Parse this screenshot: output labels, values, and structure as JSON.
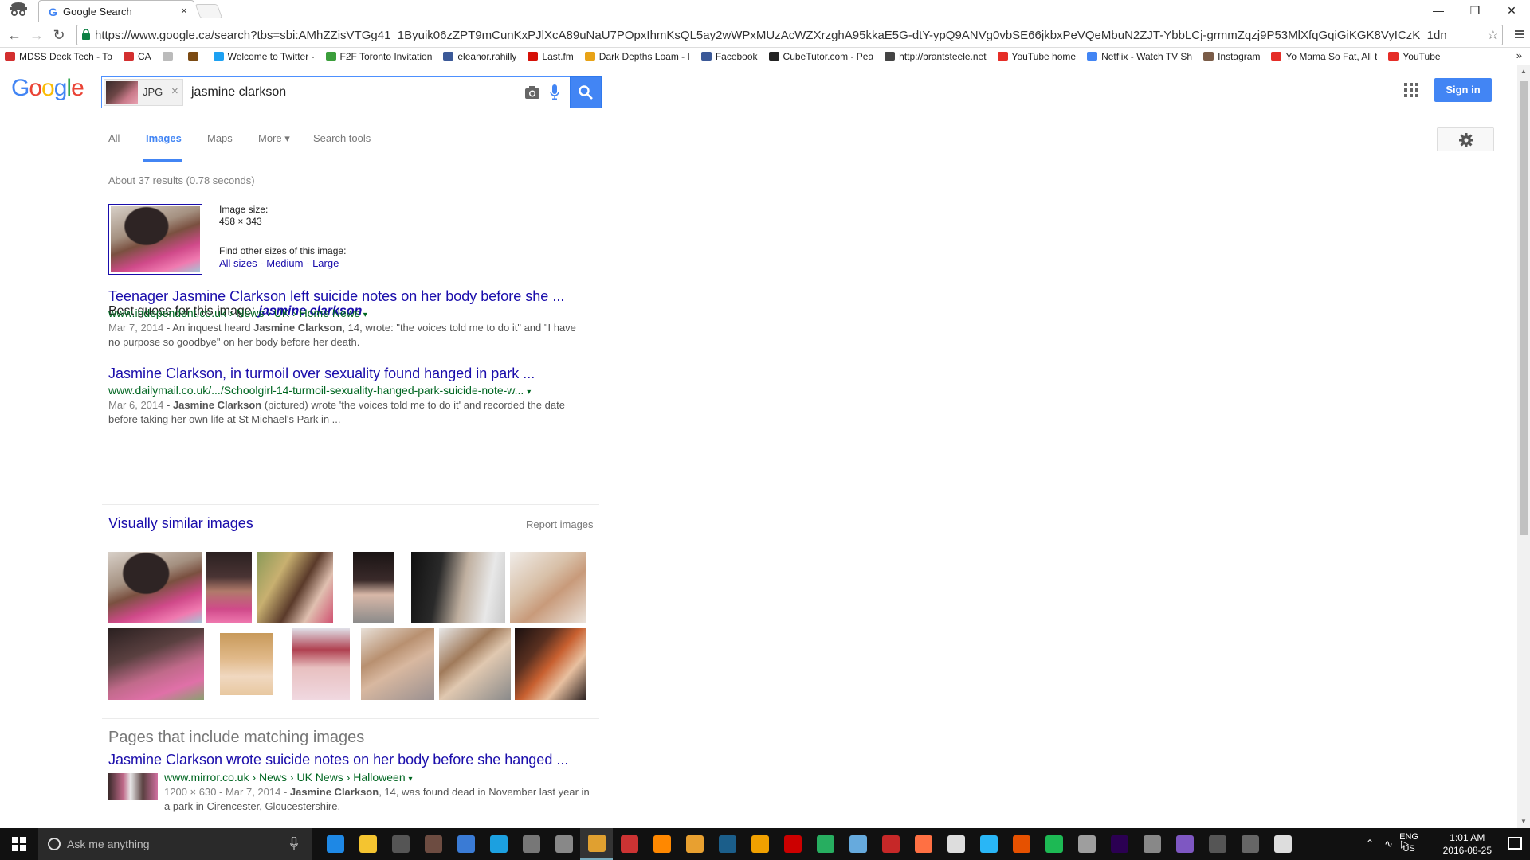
{
  "browser": {
    "tab_title": "Google Search",
    "tab_close": "×",
    "url": "https://www.google.ca/search?tbs=sbi:AMhZZisVTGg41_1Byuik06zZPT9mCunKxPJlXcA89uNaU7POpxIhmKsQL5ay2wWPxMUzAcWZXrzghA95kkaE5G-dtY-ypQ9ANVg0vbSE66jkbxPeVQeMbuN2ZJT-YbbLCj-grmmZqzj9P53MlXfqGqiGiKGK8VyICzK_1dn",
    "bookmarks": [
      {
        "label": "MDSS Deck Tech - To",
        "color": "#d32f2f"
      },
      {
        "label": "CA",
        "color": "#d32f2f"
      },
      {
        "label": "",
        "color": "#bbbbbb"
      },
      {
        "label": "",
        "color": "#7b4a12"
      },
      {
        "label": "Welcome to Twitter -",
        "color": "#1da1f2"
      },
      {
        "label": "F2F Toronto Invitation",
        "color": "#3b9e3b"
      },
      {
        "label": "eleanor.rahilly",
        "color": "#3b5998"
      },
      {
        "label": "Last.fm",
        "color": "#d51007"
      },
      {
        "label": "Dark Depths Loam - I",
        "color": "#e8a317"
      },
      {
        "label": "Facebook",
        "color": "#3b5998"
      },
      {
        "label": "CubeTutor.com - Pea",
        "color": "#222222"
      },
      {
        "label": "http://brantsteele.net",
        "color": "#444444"
      },
      {
        "label": "YouTube home",
        "color": "#e52d27"
      },
      {
        "label": "Netflix - Watch TV Sh",
        "color": "#4285f4"
      },
      {
        "label": "Instagram",
        "color": "#7a5c48"
      },
      {
        "label": "Yo Mama So Fat, All t",
        "color": "#e52d27"
      },
      {
        "label": "YouTube",
        "color": "#e52d27"
      }
    ],
    "bookmarks_more": "»"
  },
  "google": {
    "logo": [
      "G",
      "o",
      "o",
      "g",
      "l",
      "e"
    ],
    "logo_colors": [
      "#4285f4",
      "#ea4335",
      "#fbbc05",
      "#4285f4",
      "#34a853",
      "#ea4335"
    ],
    "chip_label": "JPG",
    "chip_close": "×",
    "query": "jasmine clarkson",
    "signin": "Sign in",
    "tabs": {
      "all": "All",
      "images": "Images",
      "maps": "Maps",
      "more": "More ▾",
      "tools": "Search tools"
    }
  },
  "results": {
    "stats": "About 37 results (0.78 seconds)",
    "image_size_label": "Image size:",
    "image_size_value": "458 × 343",
    "other_sizes_label": "Find other sizes of this image:",
    "size_all": "All sizes",
    "size_sep1": " - ",
    "size_medium": "Medium",
    "size_sep2": " - ",
    "size_large": "Large",
    "best_guess_label": "Best guess for this image: ",
    "best_guess_value": "jasmine clarkson",
    "items": [
      {
        "title": "Teenager Jasmine Clarkson left suicide notes on her body before she ...",
        "url": "www.independent.co.uk › News › UK › Home News",
        "date": "Mar 7, 2014",
        "snip_a": " - An inquest heard ",
        "bold": "Jasmine Clarkson",
        "snip_b": ", 14, wrote: \"the voices told me to do it\" and \"I have no purpose so goodbye\" on her body before her death."
      },
      {
        "title": "Jasmine Clarkson, in turmoil over sexuality found hanged in park ...",
        "url": "www.dailymail.co.uk/.../Schoolgirl-14-turmoil-sexuality-hanged-park-suicide-note-w...",
        "date": "Mar 6, 2014",
        "snip_a": " - ",
        "bold": "Jasmine Clarkson",
        "snip_b": " (pictured) wrote 'the voices told me to do it' and recorded the date before taking her own life at St Michael's Park in ..."
      }
    ],
    "caret": "▾",
    "visually_similar": "Visually similar images",
    "report_images": "Report images",
    "pages_heading": "Pages that include matching images",
    "page_result": {
      "title": "Jasmine Clarkson wrote suicide notes on her body before she hanged ...",
      "url": "www.mirror.co.uk › News › UK News › Halloween",
      "meta": "1200 × 630 - Mar 7, 2014 - ",
      "bold": "Jasmine Clarkson",
      "snip": ", 14, was found dead in November last year in a park in Cirencester, Gloucestershire."
    }
  },
  "taskbar": {
    "search_placeholder": "Ask me anything",
    "lang_top": "ENG",
    "lang_bottom": "US",
    "time": "1:01 AM",
    "date": "2016-08-25",
    "app_colors": [
      "#1e88e5",
      "#f4c430",
      "#555555",
      "#6d4c41",
      "#3a7bd5",
      "#1ca0e0",
      "#777777",
      "#888888",
      "#e0a030",
      "#cc3333",
      "#ff8800",
      "#e8a030",
      "#1b5e8a",
      "#f0a000",
      "#cc0000",
      "#27ae60",
      "#66aadd",
      "#c62828",
      "#ff7043",
      "#dddddd",
      "#29b6f6",
      "#e65100",
      "#1db954",
      "#9e9e9e",
      "#2b0052",
      "#888888",
      "#7e57c2",
      "#555555",
      "#666666",
      "#dddddd"
    ]
  }
}
